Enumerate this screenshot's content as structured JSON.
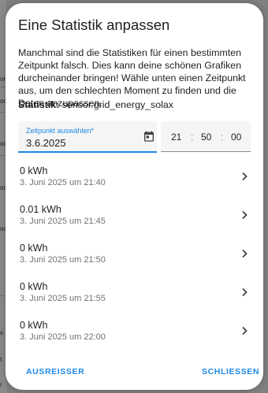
{
  "dialog": {
    "title": "Eine Statistik anpassen",
    "description": "Manchmal sind die Statistiken für einen bestimmten Zeitpunkt falsch. Dies kann deine schönen Grafiken durcheinander bringen! Wähle unten einen Zeitpunkt aus, um den schlechten Moment zu finden und die Daten anzupassen.",
    "statistic_label": "Statistik:",
    "statistic_id": "sensor.grid_energy_solax"
  },
  "date_picker": {
    "label": "Zeitpunkt auswählen*",
    "value": "3.6.2025",
    "icon": "calendar-icon"
  },
  "time_picker": {
    "hours": "21",
    "minutes": "50",
    "seconds": "00",
    "separator": ":"
  },
  "entries": [
    {
      "value": "0 kWh",
      "time": "3. Juni 2025 um 21:40"
    },
    {
      "value": "0.01 kWh",
      "time": "3. Juni 2025 um 21:45"
    },
    {
      "value": "0 kWh",
      "time": "3. Juni 2025 um 21:50"
    },
    {
      "value": "0 kWh",
      "time": "3. Juni 2025 um 21:55"
    },
    {
      "value": "0 kWh",
      "time": "3. Juni 2025 um 22:00"
    }
  ],
  "buttons": {
    "outlier": "AUSREISSER",
    "close": "SCHLIESSEN"
  },
  "background": {
    "fragments": [
      "on",
      "oc",
      "oc",
      "oc",
      "oc",
      "x",
      "t",
      "r"
    ]
  },
  "colors": {
    "accent": "#1e88e5",
    "text": "#212121",
    "secondary_text": "#727272",
    "overlay": "#808080"
  }
}
